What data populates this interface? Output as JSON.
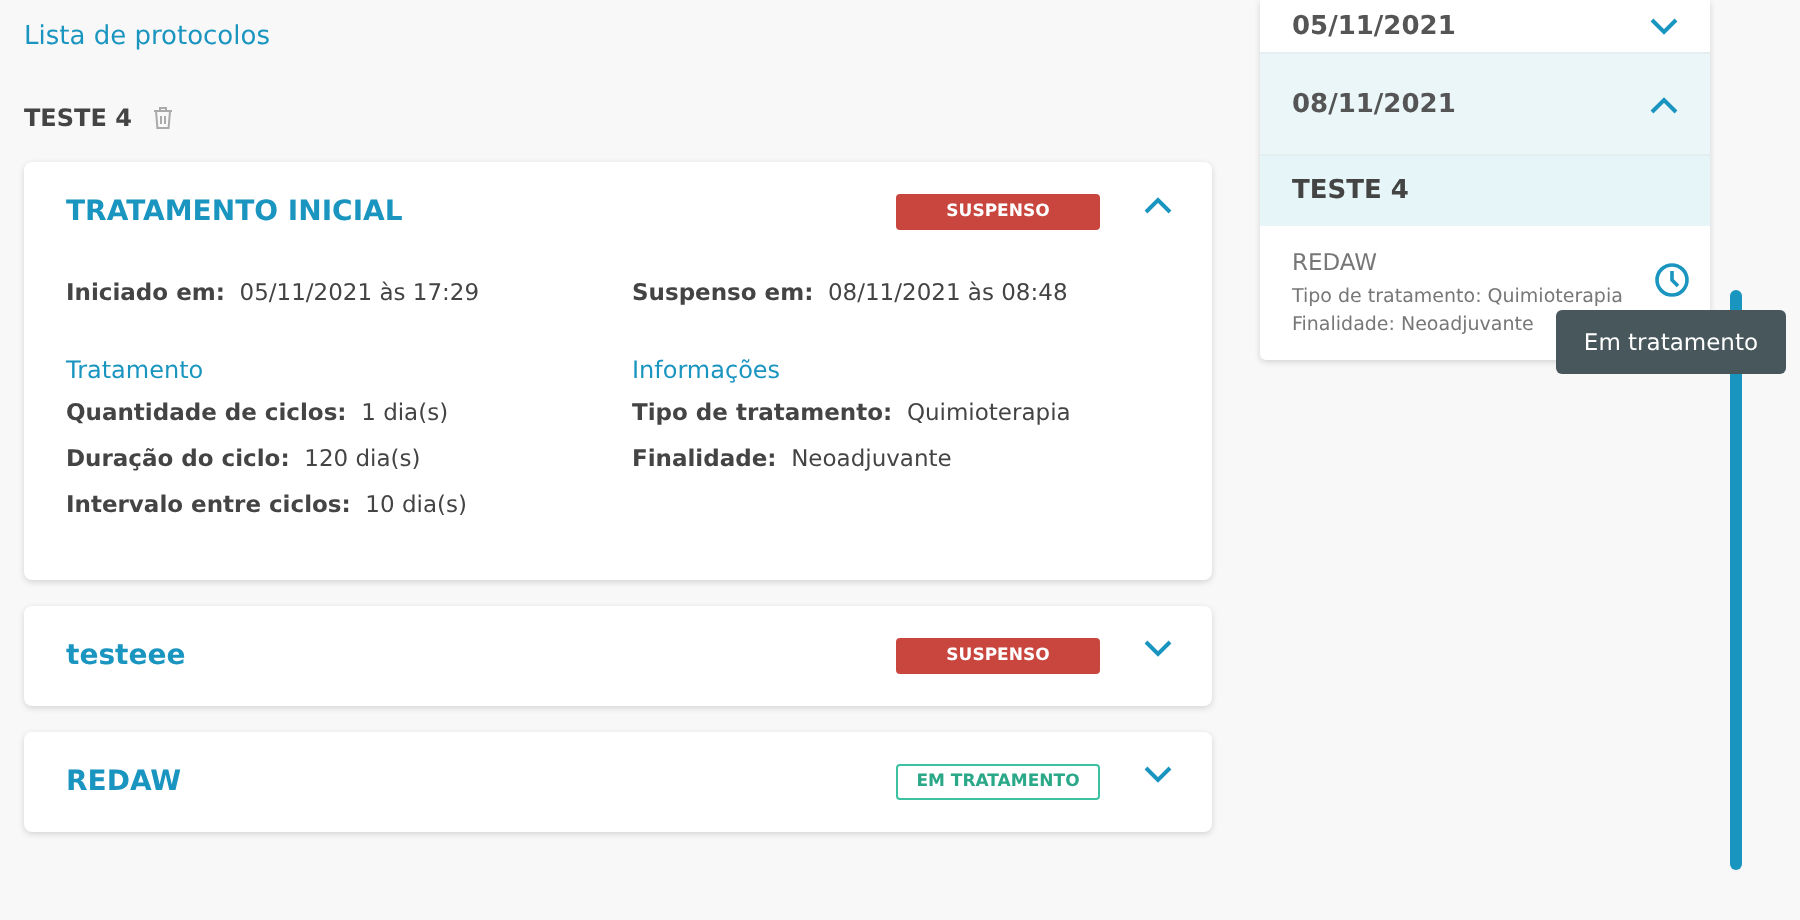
{
  "breadcrumb": "Lista de protocolos",
  "protocol": {
    "title": "TESTE 4"
  },
  "treatments": [
    {
      "title": "TRATAMENTO INICIAL",
      "status": {
        "label": "SUSPENSO",
        "kind": "suspended"
      },
      "expanded": true,
      "started": {
        "label": "Iniciado em:",
        "value": "05/11/2021 às 17:29"
      },
      "ended": {
        "label": "Suspenso em:",
        "value": "08/11/2021 às 08:48"
      },
      "sections": [
        {
          "heading": "Tratamento",
          "fields": [
            {
              "label": "Quantidade de ciclos:",
              "value": "1 dia(s)"
            },
            {
              "label": "Duração do ciclo:",
              "value": "120 dia(s)"
            },
            {
              "label": "Intervalo entre ciclos:",
              "value": "10 dia(s)"
            }
          ]
        },
        {
          "heading": "Informações",
          "fields": [
            {
              "label": "Tipo de tratamento:",
              "value": "Quimioterapia"
            },
            {
              "label": "Finalidade:",
              "value": "Neoadjuvante"
            }
          ]
        }
      ]
    },
    {
      "title": "testeee",
      "status": {
        "label": "SUSPENSO",
        "kind": "suspended"
      },
      "expanded": false
    },
    {
      "title": "REDAW",
      "status": {
        "label": "EM TRATAMENTO",
        "kind": "active"
      },
      "expanded": false
    }
  ],
  "timeline": {
    "dates": [
      {
        "date": "05/11/2021",
        "expanded": false
      },
      {
        "date": "08/11/2021",
        "expanded": true,
        "protocol": "TESTE 4",
        "entries": [
          {
            "name": "REDAW",
            "lines": [
              "Tipo de tratamento: Quimioterapia",
              "Finalidade: Neoadjuvante"
            ],
            "tooltip": "Em tratamento"
          }
        ]
      }
    ]
  }
}
